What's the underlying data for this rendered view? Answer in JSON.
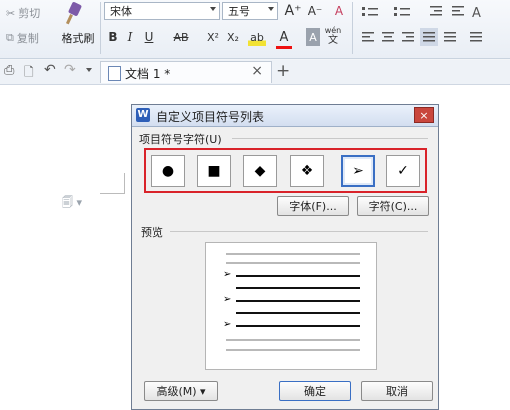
{
  "toolbar": {
    "clipboard": {
      "cut": "剪切",
      "copy": "复制",
      "format_painter": "格式刷"
    },
    "font_name": "宋体",
    "font_size": "五号",
    "buttons": {
      "grow": "A⁺",
      "shrink": "A⁻",
      "clear": "A",
      "bold": "B",
      "italic": "I",
      "underline": "U",
      "strike": "AB",
      "superscript": "X²",
      "subscript": "X₂",
      "highlight": "ab",
      "font_color": "A",
      "shading": "A",
      "phonetic_top": "wén",
      "phonetic_bottom": "文"
    }
  },
  "tabs": {
    "document": "文档 1 *",
    "close": "×",
    "new": "+"
  },
  "dialog": {
    "title": "自定义项目符号列表",
    "close": "×",
    "bullet_group_label": "项目符号字符(U)",
    "bullets": [
      "●",
      "■",
      "◆",
      "❖",
      "➢",
      "✓"
    ],
    "selected_index": 4,
    "font_button": "字体(F)...",
    "char_button": "字符(C)...",
    "preview_label": "预览",
    "advanced_button": "高级(M) ▾",
    "ok_button": "确定",
    "cancel_button": "取消",
    "preview_arrow": "➢"
  },
  "colors": {
    "selection_highlight": "#d9232a",
    "accent": "#3a6fc4"
  }
}
